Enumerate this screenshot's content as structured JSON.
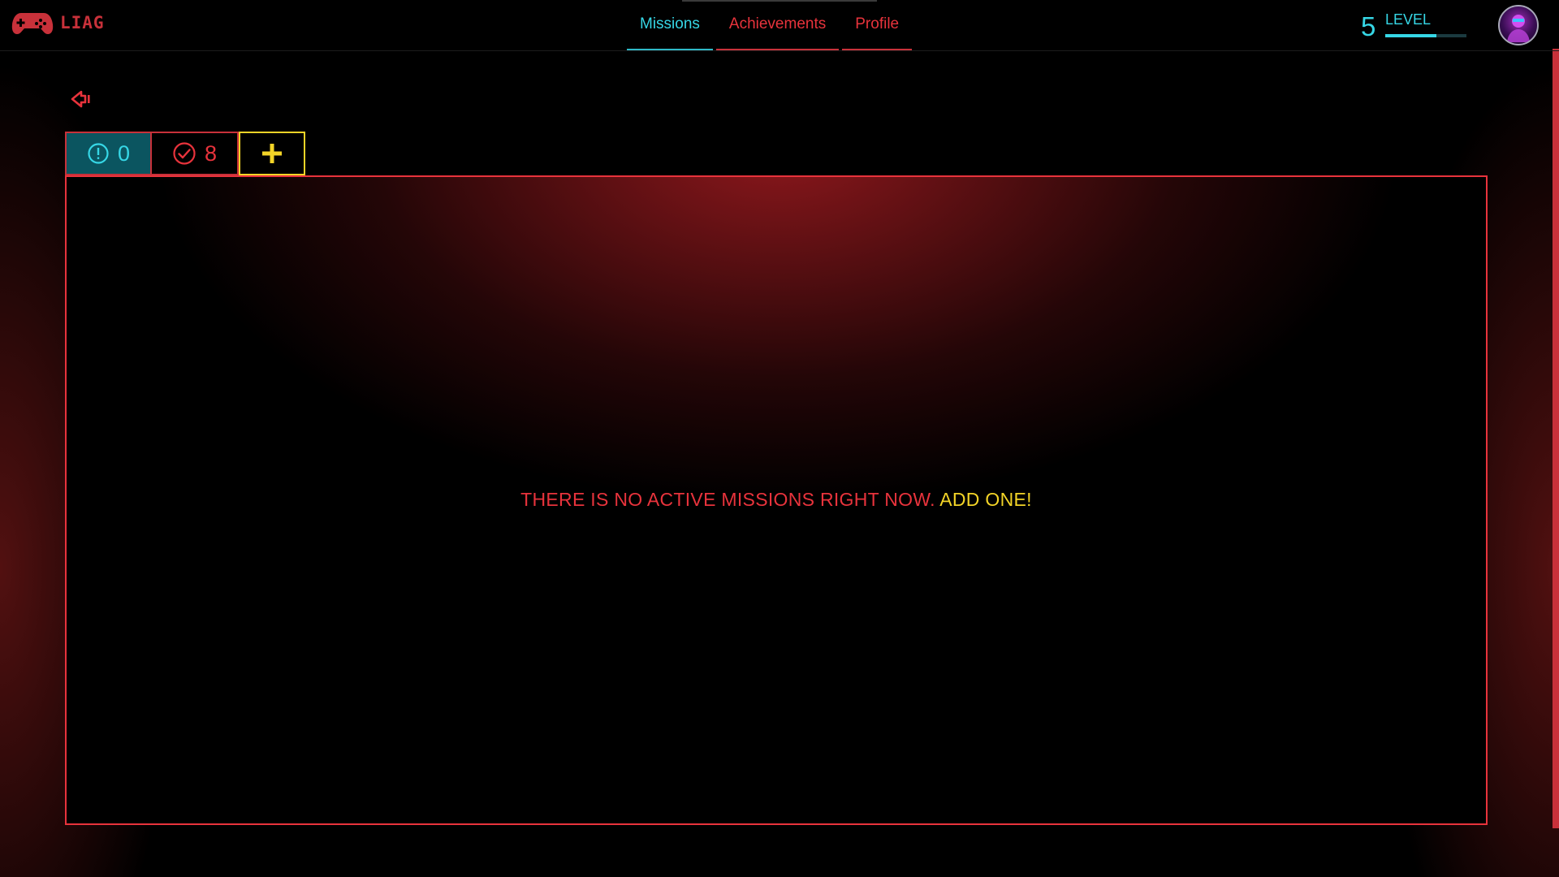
{
  "app": {
    "logo_text": "LIAG",
    "logo_icon": "gamepad-icon"
  },
  "nav": {
    "tabs": [
      {
        "label": "Missions",
        "active": true
      },
      {
        "label": "Achievements",
        "active": false
      },
      {
        "label": "Profile",
        "active": false
      }
    ]
  },
  "level": {
    "number": "5",
    "label": "LEVEL",
    "progress": 0.63
  },
  "avatar": {
    "icon": "avatar-icon"
  },
  "toolbar": {
    "back_icon": "back-arrow-icon",
    "active_count": "0",
    "completed_count": "8",
    "add_icon": "plus-icon"
  },
  "empty_state": {
    "message": "THERE IS NO ACTIVE MISSIONS RIGHT NOW. ",
    "action": "ADD ONE!"
  },
  "colors": {
    "red": "#e8333c",
    "cyan": "#36d7e6",
    "yellow": "#f3d427",
    "teal_bg": "#0b5560"
  }
}
